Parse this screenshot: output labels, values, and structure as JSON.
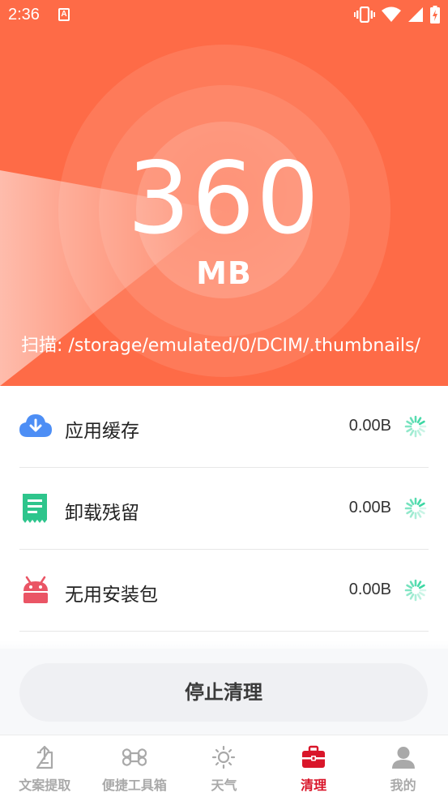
{
  "status_bar": {
    "time": "2:36",
    "badge": "A"
  },
  "scan": {
    "size_value": "360",
    "size_unit": "MB",
    "path_text": "扫描: /storage/emulated/0/DCIM/.thumbnails/",
    "hero_color": "#fe6b47"
  },
  "items": [
    {
      "label": "应用缓存",
      "size": "0.00B",
      "icon": "cloud-download-icon",
      "color": "#4d8ef5"
    },
    {
      "label": "卸载残留",
      "size": "0.00B",
      "icon": "residue-icon",
      "color": "#2ec58c"
    },
    {
      "label": "无用安装包",
      "size": "0.00B",
      "icon": "android-icon",
      "color": "#ea5565"
    }
  ],
  "stop_button": {
    "label": "停止清理"
  },
  "tabs": [
    {
      "label": "文案提取",
      "icon": "document-extract-icon",
      "active": false
    },
    {
      "label": "便捷工具箱",
      "icon": "command-icon",
      "active": false
    },
    {
      "label": "天气",
      "icon": "sun-icon",
      "active": false
    },
    {
      "label": "清理",
      "icon": "toolbox-icon",
      "active": true
    },
    {
      "label": "我的",
      "icon": "person-icon",
      "active": false
    }
  ],
  "accent_color": "#d9162a",
  "spinner_color": "#3cd7a3"
}
